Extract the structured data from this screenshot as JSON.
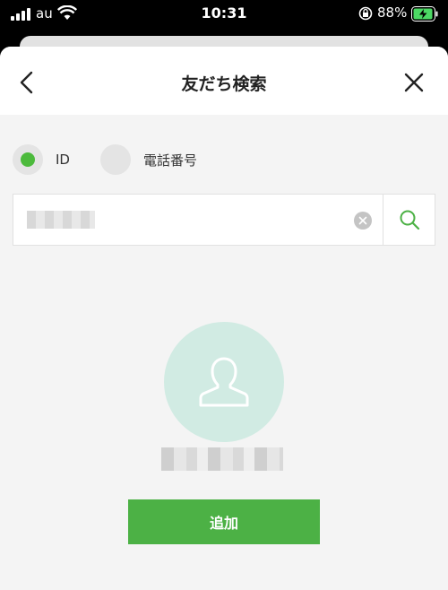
{
  "status_bar": {
    "carrier": "au",
    "time": "10:31",
    "battery_percent": "88%",
    "icons": [
      "signal-icon",
      "wifi-icon",
      "rotation-lock-icon",
      "battery-charging-icon"
    ]
  },
  "header": {
    "title": "友だち検索",
    "back_icon": "chevron-left-icon",
    "close_icon": "close-icon"
  },
  "search_type": {
    "options": [
      {
        "label": "ID",
        "selected": true
      },
      {
        "label": "電話番号",
        "selected": false
      }
    ]
  },
  "search": {
    "value": "",
    "clear_icon": "clear-icon",
    "search_icon": "search-icon"
  },
  "result": {
    "avatar_icon": "user-silhouette-icon",
    "name": "",
    "add_label": "追加"
  },
  "colors": {
    "accent": "#4cb145",
    "radio_on": "#4cba3c",
    "avatar_bg": "#d1ebe3",
    "sheet_bg": "#f4f4f4"
  }
}
